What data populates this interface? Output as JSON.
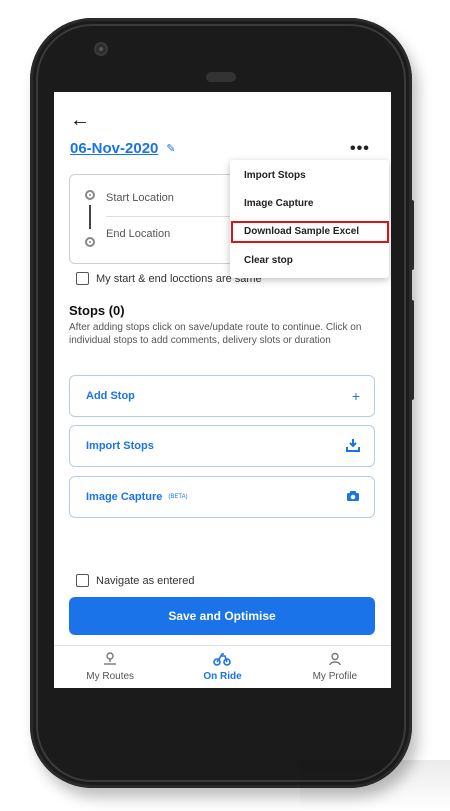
{
  "header": {
    "back_icon": "back-arrow-icon",
    "date": "06-Nov-2020",
    "edit_icon": "pencil-icon",
    "more_icon": "more-dots-icon"
  },
  "locations": {
    "start_placeholder": "Start Location",
    "end_placeholder": "End Location"
  },
  "same_location_label": "My start & end locctions are same",
  "stops": {
    "title": "Stops (0)",
    "description": "After adding stops click on save/update route to continue. Click on individual stops to add comments, delivery slots or duration"
  },
  "actions": [
    {
      "label": "Add Stop",
      "icon": "plus-icon"
    },
    {
      "label": "Import Stops",
      "icon": "download-icon"
    },
    {
      "label": "Image Capture",
      "badge": "(BETA)",
      "icon": "camera-icon"
    }
  ],
  "navigate_label": "Navigate as entered",
  "save_button": "Save and Optimise",
  "bottom_nav": [
    {
      "label": "My Routes",
      "icon": "route-pin-icon",
      "active": false
    },
    {
      "label": "On Ride",
      "icon": "bike-icon",
      "active": true
    },
    {
      "label": "My Profile",
      "icon": "person-icon",
      "active": false
    }
  ],
  "menu": {
    "items": [
      "Import Stops",
      "Image Capture",
      "Download Sample Excel",
      "Clear stop"
    ],
    "highlighted": "Download Sample Excel",
    "highlight_color": "#d8141b"
  },
  "colors": {
    "accent": "#1a73e8"
  }
}
